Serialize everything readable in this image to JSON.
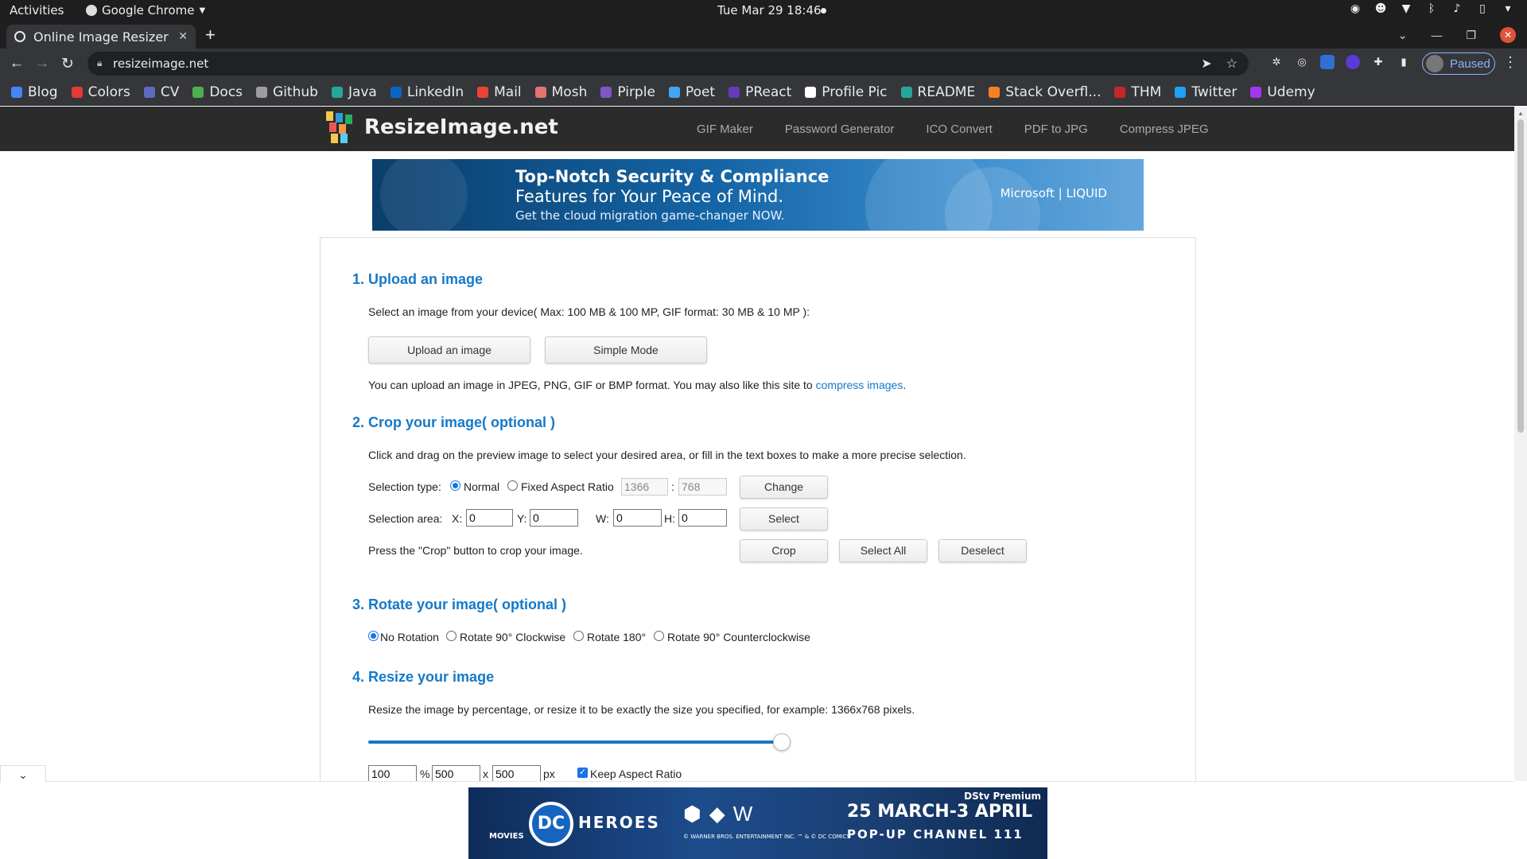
{
  "os": {
    "activities": "Activities",
    "app_name": "Google Chrome",
    "clock": "Tue Mar 29  18:46"
  },
  "browser": {
    "tab_title": "Online Image Resizer",
    "new_tab": "+",
    "url": "resizeimage.net",
    "profile_status": "Paused",
    "bookmarks": [
      {
        "label": "Blog",
        "color": "#4285f4"
      },
      {
        "label": "Colors",
        "color": "#e53935"
      },
      {
        "label": "CV",
        "color": "#5c6bc0"
      },
      {
        "label": "Docs",
        "color": "#4caf50"
      },
      {
        "label": "Github",
        "color": "#9e9e9e"
      },
      {
        "label": "Java",
        "color": "#26a69a"
      },
      {
        "label": "LinkedIn",
        "color": "#0a66c2"
      },
      {
        "label": "Mail",
        "color": "#ea4335"
      },
      {
        "label": "Mosh",
        "color": "#e57373"
      },
      {
        "label": "Pirple",
        "color": "#7e57c2"
      },
      {
        "label": "Poet",
        "color": "#42a5f5"
      },
      {
        "label": "PReact",
        "color": "#673ab7"
      },
      {
        "label": "Profile Pic",
        "color": "#ffffff"
      },
      {
        "label": "README",
        "color": "#26a69a"
      },
      {
        "label": "Stack Overfl...",
        "color": "#f48024"
      },
      {
        "label": "THM",
        "color": "#c62828"
      },
      {
        "label": "Twitter",
        "color": "#1da1f2"
      },
      {
        "label": "Udemy",
        "color": "#a435f0"
      }
    ]
  },
  "site": {
    "logo_text": "ResizeImage.net",
    "nav": [
      "GIF Maker",
      "Password Generator",
      "ICO Convert",
      "PDF to JPG",
      "Compress JPEG"
    ]
  },
  "ad_top": {
    "line1": "Top-Notch Security & Compliance",
    "line2": "Features for Your Peace of Mind.",
    "line3": "Get the cloud migration game-changer NOW.",
    "brand": "Microsoft | LIQUID"
  },
  "section1": {
    "heading": "1. Upload an image",
    "desc": "Select an image from your device( Max: 100 MB & 100 MP, GIF format: 30 MB & 10 MP ):",
    "upload_btn": "Upload an image",
    "simple_btn": "Simple Mode",
    "note": "You can upload an image in JPEG, PNG, GIF or BMP format. You may also like this site to ",
    "note_link": "compress images",
    "note_end": "."
  },
  "section2": {
    "heading": "2. Crop your image( optional )",
    "desc": "Click and drag on the preview image to select your desired area, or fill in the text boxes to make a more precise selection.",
    "selection_type_label": "Selection type:",
    "normal_label": "Normal",
    "fixed_label": "Fixed Aspect Ratio",
    "ratio_w": "1366",
    "ratio_sep": ":",
    "ratio_h": "768",
    "change_btn": "Change",
    "area_label": "Selection area:",
    "x_label": "X:",
    "x_val": "0",
    "y_label": "Y:",
    "y_val": "0",
    "w_label": "W:",
    "w_val": "0",
    "h_label": "H:",
    "h_val": "0",
    "select_btn": "Select",
    "crop_note": "Press the \"Crop\" button to crop your image.",
    "crop_btn": "Crop",
    "select_all_btn": "Select All",
    "deselect_btn": "Deselect"
  },
  "section3": {
    "heading": "3. Rotate your image( optional )",
    "options": [
      "No Rotation",
      "Rotate 90° Clockwise",
      "Rotate 180°",
      "Rotate 90° Counterclockwise"
    ],
    "selected": "No Rotation"
  },
  "section4": {
    "heading": "4. Resize your image",
    "desc": "Resize the image by percentage, or resize it to be exactly the size you specified, for example: 1366x768 pixels.",
    "percent": "100",
    "percent_unit": "%",
    "width": "500",
    "times": "x",
    "height": "500",
    "px": "px",
    "keep_aspect": "Keep Aspect Ratio",
    "slider_percent": 100
  },
  "ad_bottom": {
    "movies": "MOVIES",
    "dc": "DC",
    "heroes": "HEROES",
    "studios": "© WARNER BROS. ENTERTAINMENT INC. ™ & © DC COMICS",
    "date": "25 MARCH-3 APRIL",
    "channel": "POP-UP CHANNEL 111",
    "brand": "DStv Premium"
  }
}
